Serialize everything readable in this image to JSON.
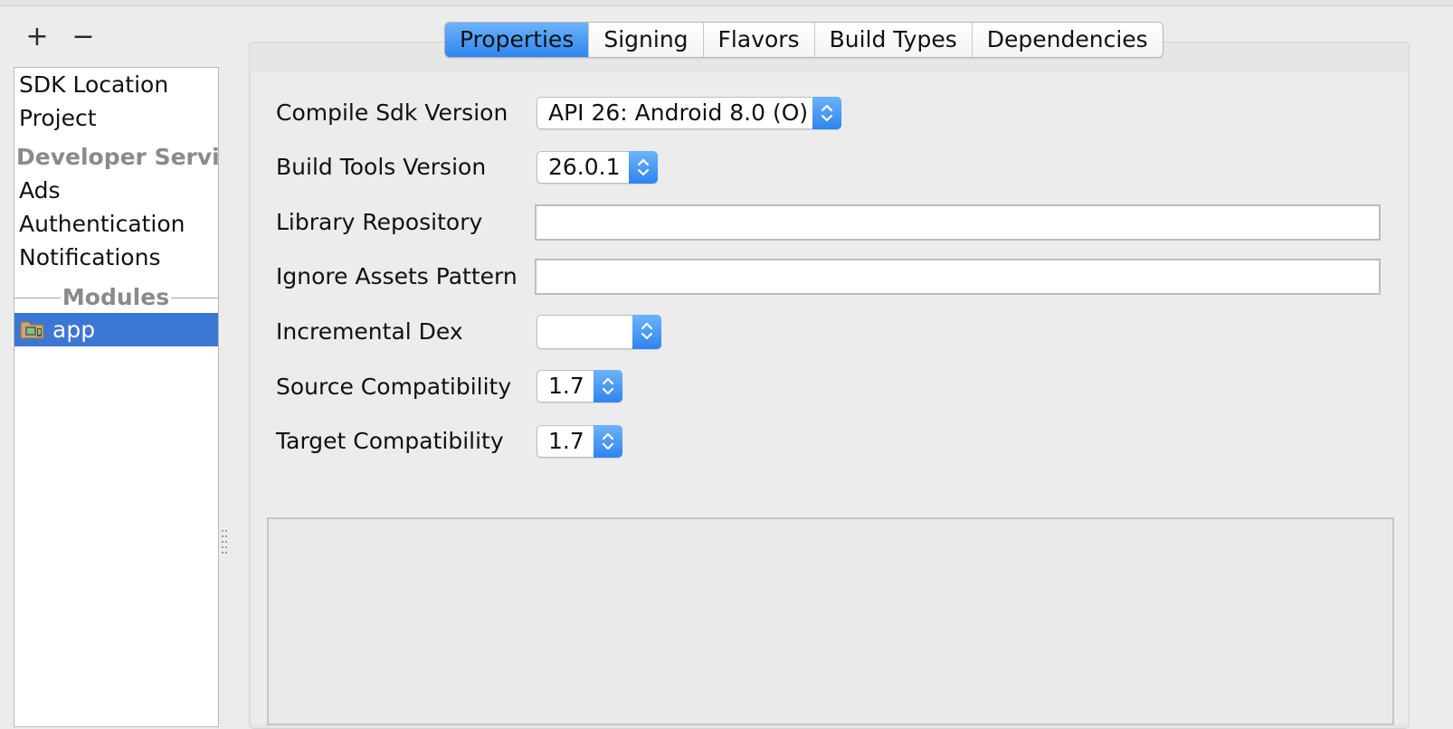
{
  "toolbar": {
    "add_label": "+",
    "remove_label": "−"
  },
  "sidebar": {
    "items": [
      {
        "label": "SDK Location"
      },
      {
        "label": "Project"
      },
      {
        "label": "Developer Servi..."
      },
      {
        "label": "Ads"
      },
      {
        "label": "Authentication"
      },
      {
        "label": "Notifications"
      }
    ],
    "modules_header": "Modules",
    "selected_module": "app",
    "selection_color": "#3d77d4"
  },
  "tabs": [
    {
      "label": "Properties",
      "active": true
    },
    {
      "label": "Signing",
      "active": false
    },
    {
      "label": "Flavors",
      "active": false
    },
    {
      "label": "Build Types",
      "active": false
    },
    {
      "label": "Dependencies",
      "active": false
    }
  ],
  "form": {
    "compile_sdk": {
      "label": "Compile Sdk Version",
      "value": "API 26: Android 8.0 (O)"
    },
    "build_tools": {
      "label": "Build Tools Version",
      "value": "26.0.1"
    },
    "library_repository": {
      "label": "Library Repository",
      "value": ""
    },
    "ignore_assets": {
      "label": "Ignore Assets Pattern",
      "value": ""
    },
    "incremental_dex": {
      "label": "Incremental Dex",
      "value": ""
    },
    "source_compat": {
      "label": "Source Compatibility",
      "value": "1.7"
    },
    "target_compat": {
      "label": "Target Compatibility",
      "value": "1.7"
    }
  },
  "accent_color": "#2f84f0"
}
